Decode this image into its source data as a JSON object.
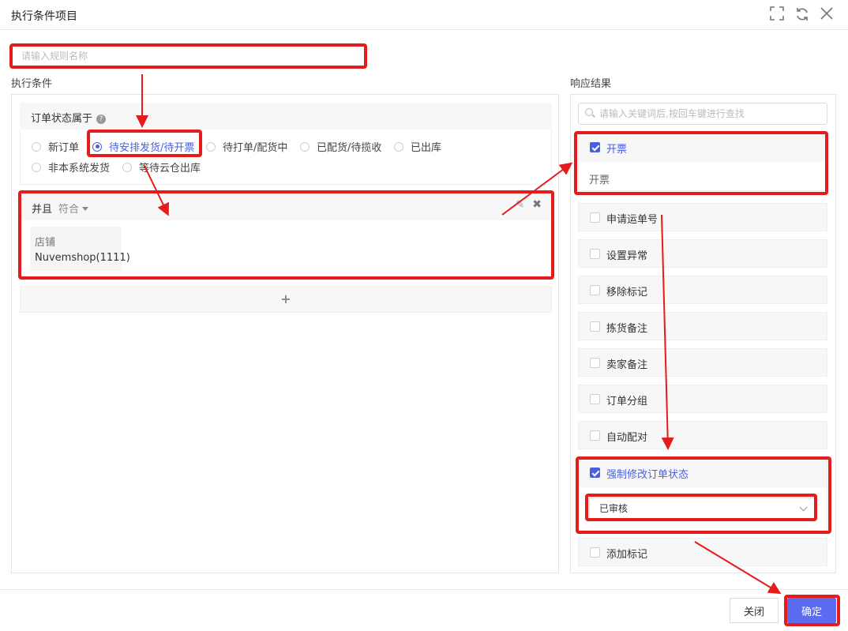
{
  "window": {
    "title": "执行条件项目",
    "controls": [
      "fullscreen-icon",
      "refresh-icon",
      "close-icon"
    ]
  },
  "rule_name": {
    "placeholder": "请输入规则名称",
    "value": ""
  },
  "conditions": {
    "section_label": "执行条件",
    "order_status": {
      "label": "订单状态属于",
      "help_icon": "question-icon",
      "options": [
        {
          "label": "新订单",
          "selected": false
        },
        {
          "label": "待安排发货/待开票",
          "selected": true
        },
        {
          "label": "待打单/配货中",
          "selected": false
        },
        {
          "label": "已配货/待揽收",
          "selected": false
        },
        {
          "label": "已出库",
          "selected": false
        },
        {
          "label": "非本系统发货",
          "selected": false
        },
        {
          "label": "等待云仓出库",
          "selected": false
        }
      ]
    },
    "group": {
      "logic": "并且",
      "match": "符合",
      "shop": {
        "key": "店铺",
        "value": "Nuvemshop(1111)"
      }
    },
    "add_symbol": "+"
  },
  "results": {
    "section_label": "响应结果",
    "search_placeholder": "请输入关键词后,按回车键进行查找",
    "invoice": {
      "label": "开票",
      "checked": true,
      "content": "开票"
    },
    "items": [
      {
        "label": "申请运单号",
        "checked": false
      },
      {
        "label": "设置异常",
        "checked": false
      },
      {
        "label": "移除标记",
        "checked": false
      },
      {
        "label": "拣货备注",
        "checked": false
      },
      {
        "label": "卖家备注",
        "checked": false
      },
      {
        "label": "订单分组",
        "checked": false
      },
      {
        "label": "自动配对",
        "checked": false
      }
    ],
    "force_status": {
      "label": "强制修改订单状态",
      "checked": true,
      "selected_value": "已审核"
    },
    "add_tag": {
      "label": "添加标记",
      "checked": false
    }
  },
  "footer": {
    "close_label": "关闭",
    "confirm_label": "确定"
  },
  "colors": {
    "accent": "#4a5fe0",
    "confirm": "#5b6cf0",
    "highlight": "#e61b1b"
  }
}
